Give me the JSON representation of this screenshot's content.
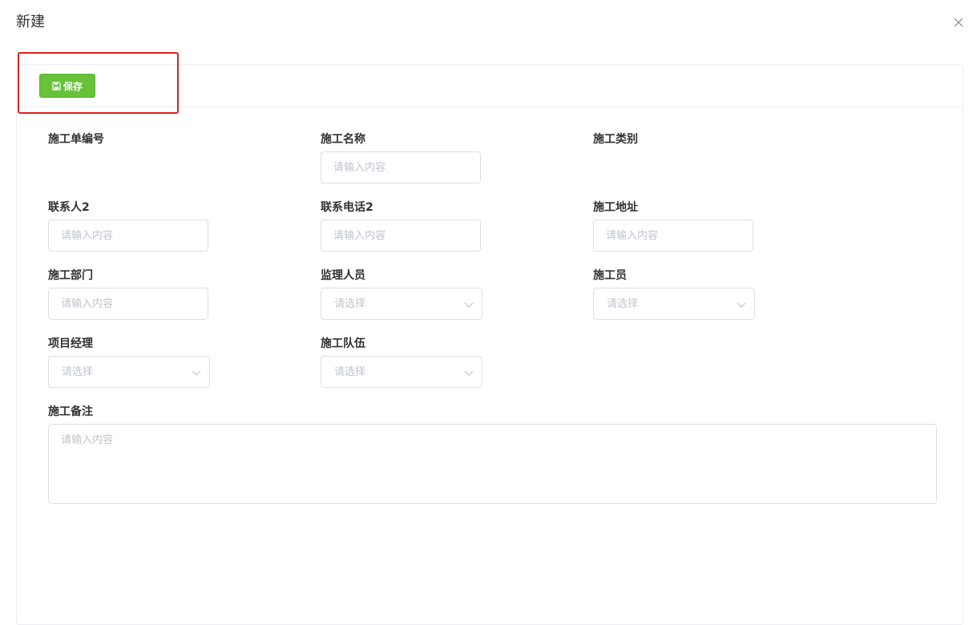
{
  "dialog": {
    "title": "新建"
  },
  "toolbar": {
    "save_label": "保存"
  },
  "form": {
    "construction_no": {
      "label": "施工单编号"
    },
    "construction_name": {
      "label": "施工名称",
      "placeholder": "请输入内容"
    },
    "construction_type": {
      "label": "施工类别"
    },
    "contact2": {
      "label": "联系人2",
      "placeholder": "请输入内容"
    },
    "phone2": {
      "label": "联系电话2",
      "placeholder": "请输入内容"
    },
    "address": {
      "label": "施工地址",
      "placeholder": "请输入内容"
    },
    "department": {
      "label": "施工部门",
      "placeholder": "请输入内容"
    },
    "supervisor": {
      "label": "监理人员",
      "placeholder": "请选择"
    },
    "worker": {
      "label": "施工员",
      "placeholder": "请选择"
    },
    "project_manager": {
      "label": "项目经理",
      "placeholder": "请选择"
    },
    "team": {
      "label": "施工队伍",
      "placeholder": "请选择"
    },
    "remark": {
      "label": "施工备注",
      "placeholder": "请输入内容"
    }
  },
  "colors": {
    "save_button": "#67c23a",
    "highlight": "#e02020",
    "border": "#dcdfe6"
  }
}
